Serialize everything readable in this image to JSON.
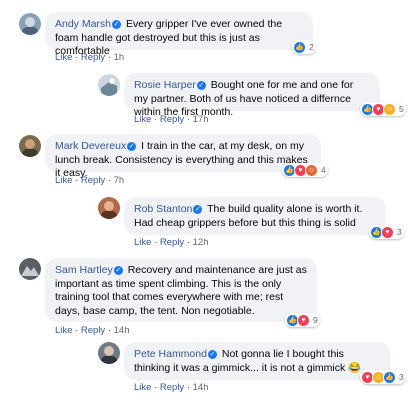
{
  "comments": [
    {
      "author": "Andy Marsh",
      "text": "Every gripper I've ever owned the foam handle got destroyed but this is just as comfortable",
      "like": "Like",
      "reply": "Reply",
      "time": "1h",
      "reaction_count": "2",
      "reactions": [
        "like-icon"
      ],
      "avatar_color": "#8aa1b5"
    },
    {
      "author": "Rosie Harper",
      "text": "Bought one for me and one for my partner. Both of us have noticed a differnce within the first month.",
      "like": "Like",
      "reply": "Reply",
      "time": "17h",
      "reaction_count": "5",
      "reactions": [
        "like-icon",
        "love-icon",
        "haha-icon"
      ],
      "avatar_color": "#9fb6c7"
    },
    {
      "author": "Mark Devereux",
      "text": "I train in the car, at my desk, on my lunch break. Consistency is everything and this makes it easy.",
      "like": "Like",
      "reply": "Reply",
      "time": "7h",
      "reaction_count": "4",
      "reactions": [
        "like-icon",
        "love-icon",
        "care-icon"
      ],
      "avatar_color": "#7a6a4e"
    },
    {
      "author": "Rob Stanton",
      "text": "The build quality alone is worth it. Had cheap grippers before but this thing is solid",
      "like": "Like",
      "reply": "Reply",
      "time": "12h",
      "reaction_count": "3",
      "reactions": [
        "like-icon",
        "love-icon"
      ],
      "avatar_color": "#b06a4a"
    },
    {
      "author": "Sam Hartley",
      "text": "Recovery and maintenance are just as important as time spent climbing. This is the only training tool that comes everywhere with me; rest days, base camp, the tent. Non negotiable.",
      "like": "Like",
      "reply": "Reply",
      "time": "14h",
      "reaction_count": "9",
      "reactions": [
        "like-icon",
        "love-icon"
      ],
      "avatar_color": "#5a5f66"
    },
    {
      "author": "Pete Hammond",
      "text": "Not gonna lie I bought this thinking it was a gimmick... it is not a gimmick 😂",
      "like": "Like",
      "reply": "Reply",
      "time": "14h",
      "reaction_count": "3",
      "reactions": [
        "love-icon",
        "haha-icon",
        "like-icon"
      ],
      "avatar_color": "#6f7a86"
    }
  ],
  "separator": "·",
  "colors": {
    "bubble": "#f0f2f5",
    "author": "#385898",
    "meta": "#65676b",
    "verified": "#1877f2"
  }
}
